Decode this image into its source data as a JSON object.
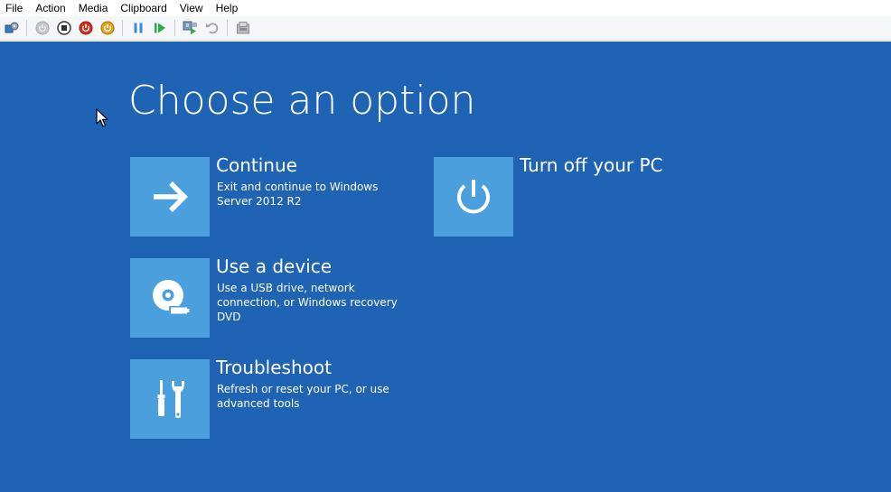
{
  "menu": {
    "items": [
      "File",
      "Action",
      "Media",
      "Clipboard",
      "View",
      "Help"
    ]
  },
  "toolbar": {
    "buttons": [
      {
        "icon": "settings-icon"
      },
      {
        "icon": "start-icon"
      },
      {
        "icon": "turn-off-icon"
      },
      {
        "icon": "shut-down-icon"
      },
      {
        "icon": "save-icon"
      },
      {
        "icon": "pause-icon"
      },
      {
        "icon": "reset-icon"
      },
      {
        "icon": "checkpoint-icon"
      },
      {
        "icon": "revert-icon"
      },
      {
        "icon": "enhanced-session-icon"
      }
    ]
  },
  "screen": {
    "background": "#1f64b4",
    "tile_color": "#4a9fdc",
    "title": "Choose an option",
    "options": [
      {
        "title": "Continue",
        "description": "Exit and continue to Windows Server 2012 R2",
        "icon": "arrow-right-icon"
      },
      {
        "title": "Turn off your PC",
        "description": "",
        "icon": "power-icon"
      },
      {
        "title": "Use a device",
        "description": "Use a USB drive, network connection, or Windows recovery DVD",
        "icon": "disc-device-icon"
      },
      {
        "title": "Troubleshoot",
        "description": "Refresh or reset your PC, or use advanced tools",
        "icon": "tools-icon"
      }
    ]
  }
}
